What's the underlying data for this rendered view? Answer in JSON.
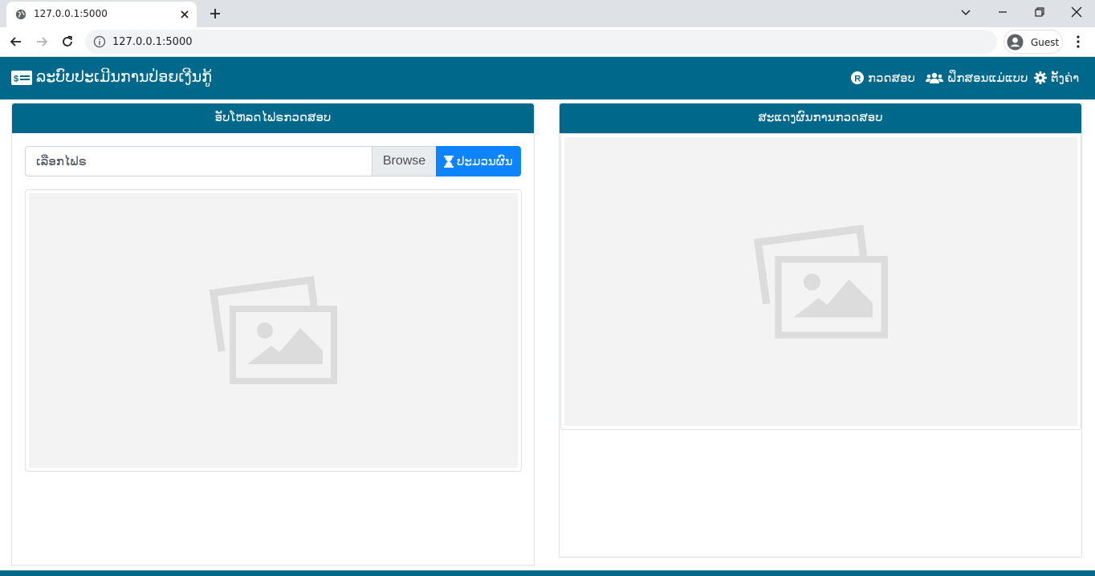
{
  "browser": {
    "tab_title": "127.0.0.1:5000",
    "url": "127.0.0.1:5000",
    "profile_label": "Guest"
  },
  "navbar": {
    "brand": "ລະບົບປະເມີນການປ່ອຍເງີນກູ້",
    "brand_icon": "money-card-icon",
    "items": [
      {
        "label": "ກວດສອບ",
        "icon": "registered-icon"
      },
      {
        "label": "ຝຶກສອນແມ່ແບບ",
        "icon": "users-icon"
      },
      {
        "label": "ຕັ້ງຄ່າ",
        "icon": "gear-icon"
      }
    ]
  },
  "upload_panel": {
    "title": "ອັບໂຫລດໄຟຣກວດສອບ",
    "file_placeholder": "ເລືອກໄຟຣ",
    "browse_label": "Browse",
    "predict_label": "ປະມວນຜົນ",
    "predict_icon": "hourglass-icon",
    "preview_icon": "image-placeholder-icon"
  },
  "result_panel": {
    "title": "ສະແດງຜົນການກວດສອບ",
    "preview_icon": "image-placeholder-icon"
  },
  "colors": {
    "brand": "#00688b",
    "primary_button": "#0d84fd",
    "placeholder_bg": "#f3f3f3"
  }
}
